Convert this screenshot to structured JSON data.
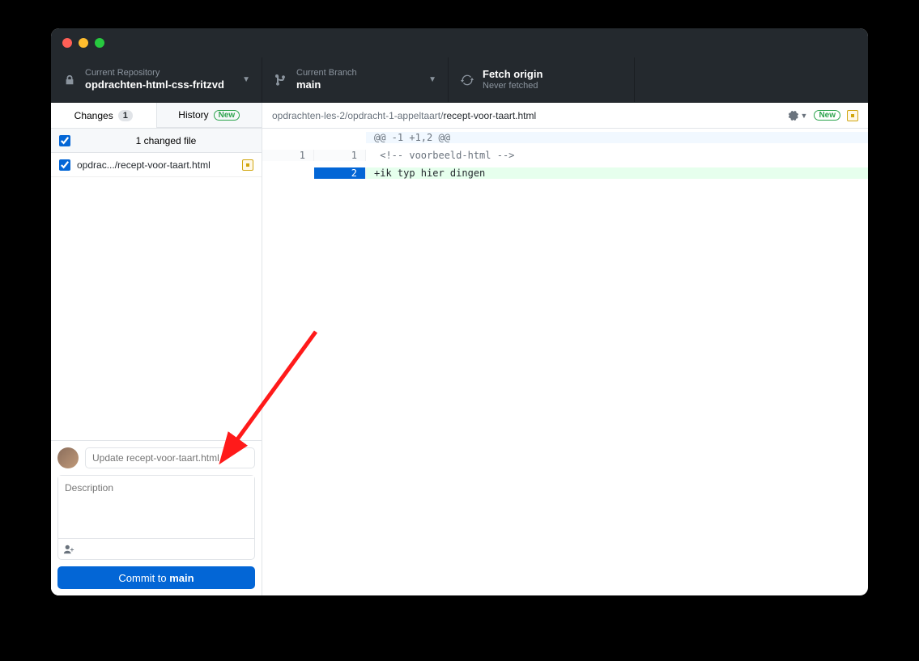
{
  "toolbar": {
    "repo": {
      "label": "Current Repository",
      "value": "opdrachten-html-css-fritzvd"
    },
    "branch": {
      "label": "Current Branch",
      "value": "main"
    },
    "fetch": {
      "label": "Fetch origin",
      "sub": "Never fetched"
    }
  },
  "tabs": {
    "changes": {
      "label": "Changes",
      "count": "1"
    },
    "history": {
      "label": "History",
      "badge": "New"
    }
  },
  "changes": {
    "header": "1 changed file",
    "files": [
      {
        "name": "opdrac.../recept-voor-taart.html"
      }
    ]
  },
  "commit": {
    "summary_placeholder": "Update recept-voor-taart.html",
    "description_placeholder": "Description",
    "button_prefix": "Commit to ",
    "button_branch": "main"
  },
  "file": {
    "path_dim": "opdrachten-les-2/opdracht-1-appeltaart/",
    "path_cur": "recept-voor-taart.html",
    "badge": "New"
  },
  "diff": {
    "hunk": "@@ -1 +1,2 @@",
    "rows": [
      {
        "old": "1",
        "new": "1",
        "text": " <!-- voorbeeld-html -->",
        "type": "ctx"
      },
      {
        "old": "",
        "new": "2",
        "text": "+ik typ hier dingen",
        "type": "add",
        "selected": true
      }
    ]
  }
}
